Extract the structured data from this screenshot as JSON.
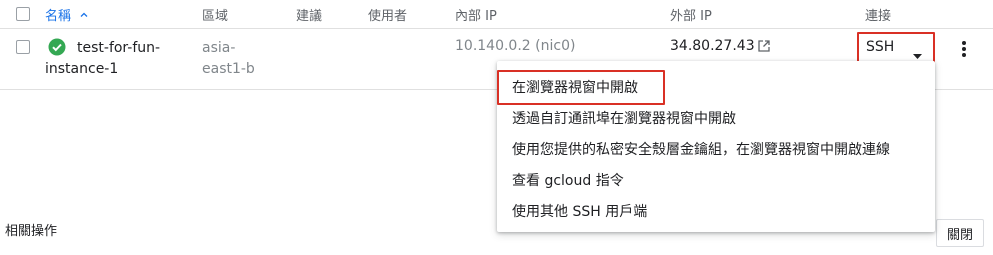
{
  "table": {
    "headers": {
      "name": "名稱",
      "sort_icon": "arrow-up-icon",
      "zone": "區域",
      "recommendation": "建議",
      "in_use_by": "使用者",
      "internal_ip": "內部 IP",
      "external_ip": "外部 IP",
      "connect": "連接"
    },
    "rows": [
      {
        "status_icon": "check-circle-icon",
        "status_color": "#34a853",
        "name_line1": "test-for-fun-",
        "name_line2": "instance-1",
        "zone_line1": "asia-",
        "zone_line2": "east1-b",
        "internal_ip": "10.140.0.2 (nic0)",
        "external_ip": "34.80.27.43",
        "external_link_icon": "open-in-new-icon",
        "connect_label": "SSH",
        "connect_dropdown_icon": "caret-down-icon",
        "more_icon": "more-vert-icon"
      }
    ]
  },
  "ssh_menu": {
    "items": [
      "在瀏覽器視窗中開啟",
      "透過自訂通訊埠在瀏覽器視窗中開啟",
      "使用您提供的私密安全殼層金鑰組，在瀏覽器視窗中開啟連線",
      "查看 gcloud 指令",
      "使用其他 SSH 用戶端"
    ]
  },
  "related_actions": {
    "label": "相關操作",
    "close_button": "關閉"
  },
  "colors": {
    "accent": "#1a73e8",
    "highlight": "#d93025",
    "status_ok": "#34a853"
  }
}
